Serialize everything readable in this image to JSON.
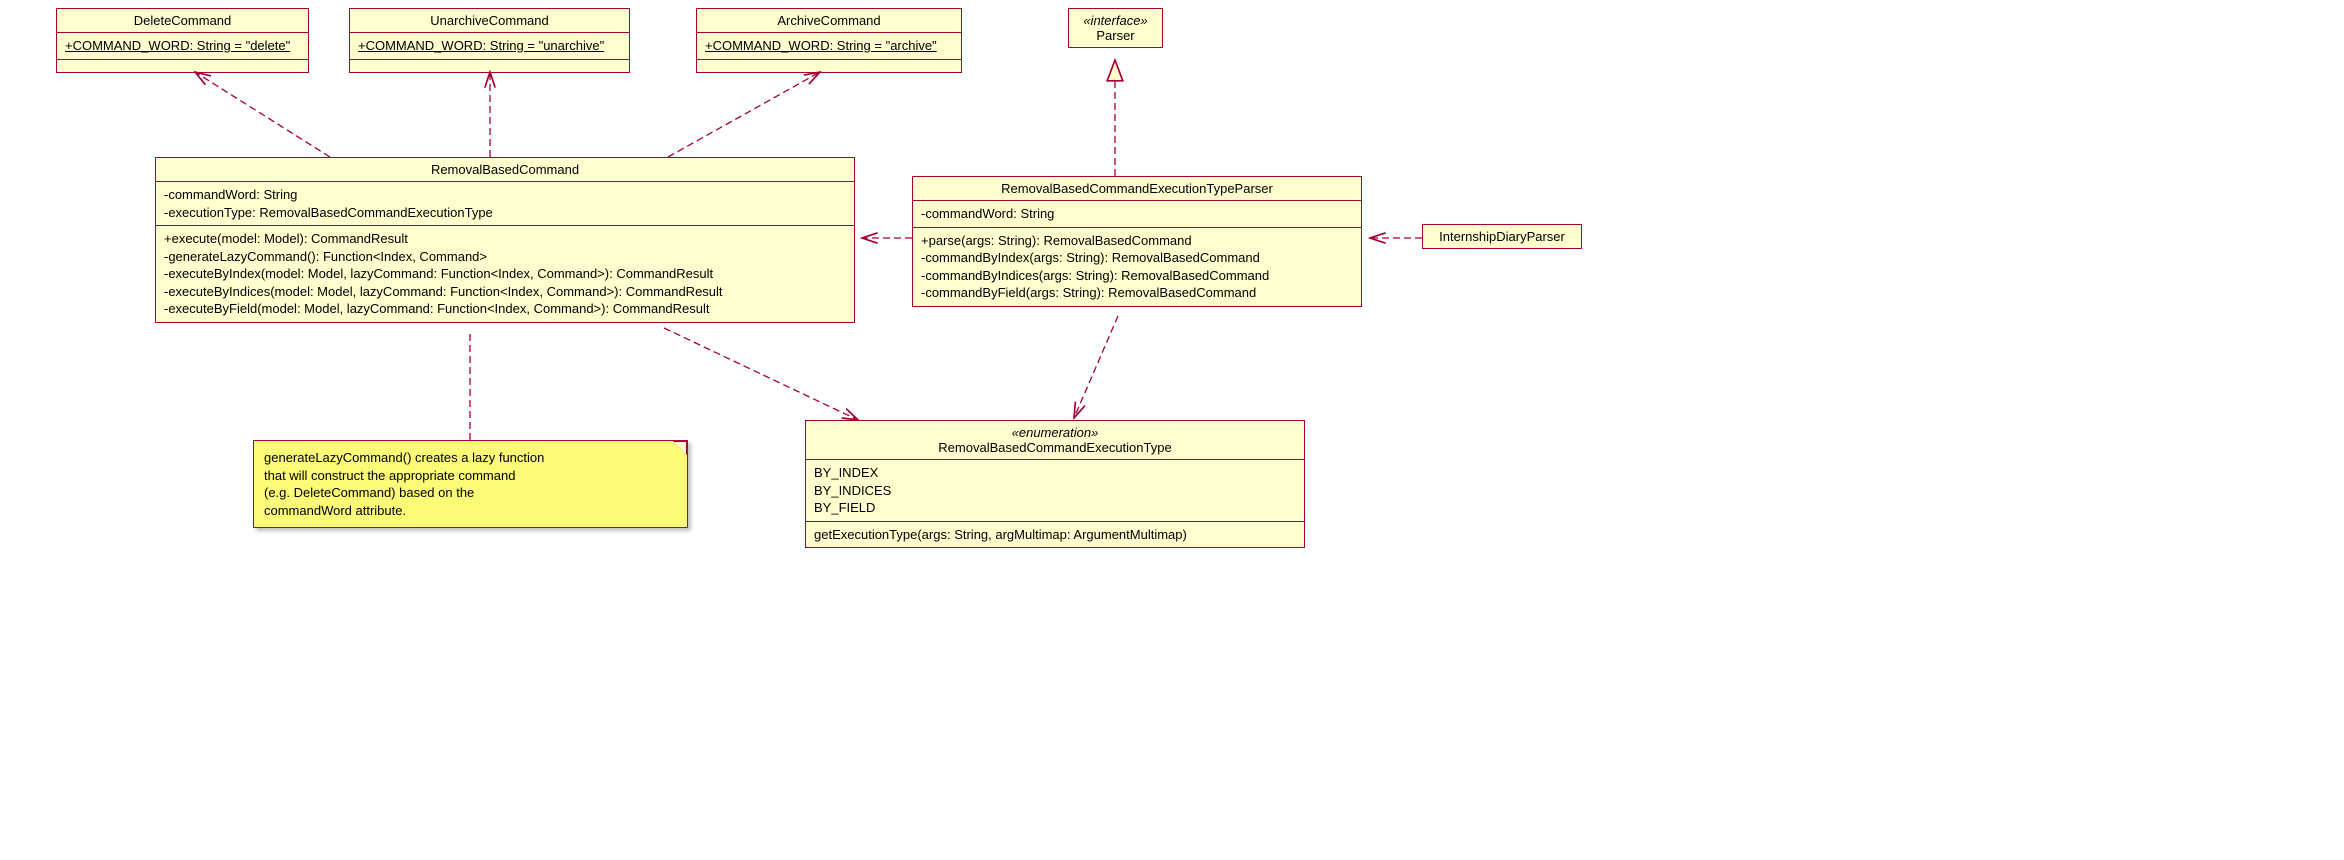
{
  "classes": {
    "delete": {
      "name": "DeleteCommand",
      "attr": "+COMMAND_WORD: String = \"delete\""
    },
    "unarchive": {
      "name": "UnarchiveCommand",
      "attr": "+COMMAND_WORD: String = \"unarchive\""
    },
    "archive": {
      "name": "ArchiveCommand",
      "attr": "+COMMAND_WORD: String = \"archive\""
    },
    "parser": {
      "stereo": "«interface»",
      "name": "Parser"
    },
    "removal": {
      "name": "RemovalBasedCommand",
      "attrs": [
        "-commandWord: String",
        "-executionType: RemovalBasedCommandExecutionType"
      ],
      "ops": [
        "+execute(model: Model): CommandResult",
        "-generateLazyCommand(): Function<Index, Command>",
        "-executeByIndex(model: Model, lazyCommand: Function<Index, Command>): CommandResult",
        "-executeByIndices(model: Model, lazyCommand: Function<Index, Command>): CommandResult",
        "-executeByField(model: Model, lazyCommand: Function<Index, Command>): CommandResult"
      ]
    },
    "exectype_parser": {
      "name": "RemovalBasedCommandExecutionTypeParser",
      "attrs": [
        "-commandWord: String"
      ],
      "ops": [
        "+parse(args: String): RemovalBasedCommand",
        "-commandByIndex(args: String): RemovalBasedCommand",
        "-commandByIndices(args: String): RemovalBasedCommand",
        "-commandByField(args: String): RemovalBasedCommand"
      ]
    },
    "diary": {
      "name": "InternshipDiaryParser"
    },
    "enum": {
      "stereo": "«enumeration»",
      "name": "RemovalBasedCommandExecutionType",
      "vals": [
        "BY_INDEX",
        "BY_INDICES",
        "BY_FIELD"
      ],
      "op": "getExecutionType(args: String, argMultimap: ArgumentMultimap)"
    }
  },
  "note": {
    "l1": "generateLazyCommand() creates a lazy function",
    "l2": "that will construct the appropriate command",
    "l3": "(e.g. DeleteCommand) based on the",
    "l4": "commandWord attribute."
  },
  "chart_data": {
    "type": "uml-class-diagram",
    "classes": [
      {
        "id": "DeleteCommand",
        "attributes": [
          "+COMMAND_WORD: String = \"delete\""
        ]
      },
      {
        "id": "UnarchiveCommand",
        "attributes": [
          "+COMMAND_WORD: String = \"unarchive\""
        ]
      },
      {
        "id": "ArchiveCommand",
        "attributes": [
          "+COMMAND_WORD: String = \"archive\""
        ]
      },
      {
        "id": "Parser",
        "stereotype": "interface"
      },
      {
        "id": "RemovalBasedCommand",
        "attributes": [
          "-commandWord: String",
          "-executionType: RemovalBasedCommandExecutionType"
        ],
        "operations": [
          "+execute(model: Model): CommandResult",
          "-generateLazyCommand(): Function<Index, Command>",
          "-executeByIndex(model: Model, lazyCommand: Function<Index, Command>): CommandResult",
          "-executeByIndices(model: Model, lazyCommand: Function<Index, Command>): CommandResult",
          "-executeByField(model: Model, lazyCommand: Function<Index, Command>): CommandResult"
        ]
      },
      {
        "id": "RemovalBasedCommandExecutionTypeParser",
        "attributes": [
          "-commandWord: String"
        ],
        "operations": [
          "+parse(args: String): RemovalBasedCommand",
          "-commandByIndex(args: String): RemovalBasedCommand",
          "-commandByIndices(args: String): RemovalBasedCommand",
          "-commandByField(args: String): RemovalBasedCommand"
        ]
      },
      {
        "id": "InternshipDiaryParser"
      },
      {
        "id": "RemovalBasedCommandExecutionType",
        "stereotype": "enumeration",
        "values": [
          "BY_INDEX",
          "BY_INDICES",
          "BY_FIELD"
        ],
        "operations": [
          "getExecutionType(args: String, argMultimap: ArgumentMultimap)"
        ]
      }
    ],
    "relationships": [
      {
        "from": "RemovalBasedCommand",
        "to": "DeleteCommand",
        "type": "dependency-arrow"
      },
      {
        "from": "RemovalBasedCommand",
        "to": "UnarchiveCommand",
        "type": "dependency-arrow"
      },
      {
        "from": "RemovalBasedCommand",
        "to": "ArchiveCommand",
        "type": "dependency-arrow"
      },
      {
        "from": "RemovalBasedCommandExecutionTypeParser",
        "to": "Parser",
        "type": "realization"
      },
      {
        "from": "RemovalBasedCommandExecutionTypeParser",
        "to": "RemovalBasedCommand",
        "type": "dependency-arrow"
      },
      {
        "from": "InternshipDiaryParser",
        "to": "RemovalBasedCommandExecutionTypeParser",
        "type": "dependency-arrow"
      },
      {
        "from": "RemovalBasedCommand",
        "to": "RemovalBasedCommandExecutionType",
        "type": "dependency-arrow"
      },
      {
        "from": "RemovalBasedCommandExecutionTypeParser",
        "to": "RemovalBasedCommandExecutionType",
        "type": "dependency-arrow"
      },
      {
        "from": "Note",
        "to": "RemovalBasedCommand",
        "type": "note-anchor"
      }
    ],
    "notes": [
      {
        "text": "generateLazyCommand() creates a lazy function that will construct the appropriate command (e.g. DeleteCommand) based on the commandWord attribute.",
        "anchor": "RemovalBasedCommand"
      }
    ]
  }
}
